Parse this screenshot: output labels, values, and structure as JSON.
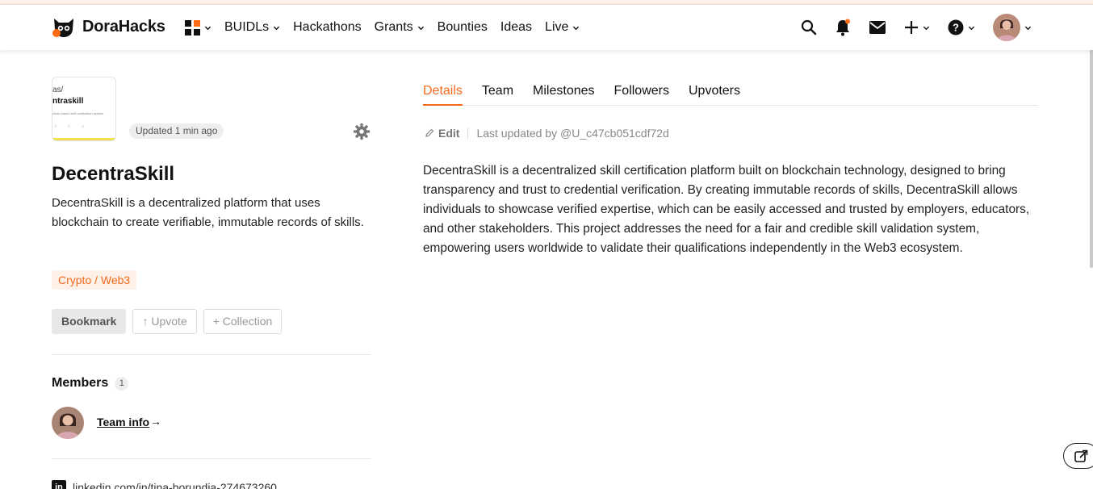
{
  "header": {
    "logo_text": "DoraHacks",
    "nav": {
      "buidls": "BUIDLs",
      "hackathons": "Hackathons",
      "grants": "Grants",
      "bounties": "Bounties",
      "ideas": "Ideas",
      "live": "Live"
    },
    "accent_color": "#ff6a13"
  },
  "project": {
    "thumbnail": {
      "line1": "as/",
      "line2": "ntraskill",
      "line3": "chain based skill verification system"
    },
    "updated": "Updated 1 min ago",
    "title": "DecentraSkill",
    "short_description": "DecentraSkill is a decentralized platform that uses blockchain to create verifiable, immutable records of skills.",
    "tag": "Crypto / Web3",
    "buttons": {
      "bookmark": "Bookmark",
      "upvote": "↑ Upvote",
      "collection": "+ Collection"
    }
  },
  "members": {
    "label": "Members",
    "count": "1",
    "team_info": "Team info",
    "arrow": "→"
  },
  "linkedin": {
    "url": "linkedin.com/in/tina-borundia-274673260"
  },
  "tabs": [
    "Details",
    "Team",
    "Milestones",
    "Followers",
    "Upvoters"
  ],
  "details": {
    "edit": "Edit",
    "last_updated": "Last updated by @U_c47cb051cdf72d",
    "body": "DecentraSkill is a decentralized skill certification platform built on blockchain technology, designed to bring transparency and trust to credential verification. By creating immutable records of skills, DecentraSkill allows individuals to showcase verified expertise, which can be easily accessed and trusted by employers, educators, and other stakeholders. This project addresses the need for a fair and credible skill validation system, empowering users worldwide to validate their qualifications independently in the Web3 ecosystem."
  },
  "icons": {
    "search": "search-icon",
    "bell": "bell-icon",
    "mail": "mail-icon",
    "plus": "plus-icon",
    "help": "help-icon",
    "gear": "gear-icon",
    "share": "share-icon",
    "pencil": "pencil-icon"
  }
}
